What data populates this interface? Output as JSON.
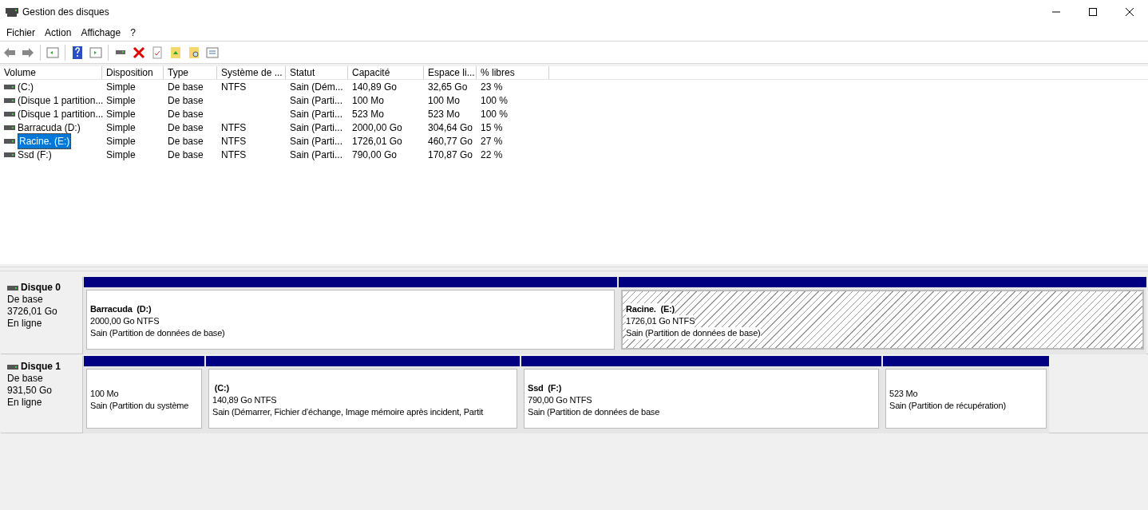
{
  "window": {
    "title": "Gestion des disques"
  },
  "menu": [
    "Fichier",
    "Action",
    "Affichage",
    "?"
  ],
  "table": {
    "columns": [
      "Volume",
      "Disposition",
      "Type",
      "Système de ...",
      "Statut",
      "Capacité",
      "Espace li...",
      "% libres"
    ],
    "rows": [
      {
        "selected": false,
        "cells": [
          " (C:)",
          "Simple",
          "De base",
          "NTFS",
          "Sain (Dém...",
          "140,89 Go",
          "32,65 Go",
          "23 %"
        ]
      },
      {
        "selected": false,
        "cells": [
          "(Disque 1 partition...",
          "Simple",
          "De base",
          "",
          "Sain (Parti...",
          "100 Mo",
          "100 Mo",
          "100 %"
        ]
      },
      {
        "selected": false,
        "cells": [
          "(Disque 1 partition...",
          "Simple",
          "De base",
          "",
          "Sain (Parti...",
          "523 Mo",
          "523 Mo",
          "100 %"
        ]
      },
      {
        "selected": false,
        "cells": [
          "Barracuda (D:)",
          "Simple",
          "De base",
          "NTFS",
          "Sain (Parti...",
          "2000,00 Go",
          "304,64 Go",
          "15 %"
        ]
      },
      {
        "selected": true,
        "cells": [
          "Racine. (E:)",
          "Simple",
          "De base",
          "NTFS",
          "Sain (Parti...",
          "1726,01 Go",
          "460,77 Go",
          "27 %"
        ]
      },
      {
        "selected": false,
        "cells": [
          "Ssd (F:)",
          "Simple",
          "De base",
          "NTFS",
          "Sain (Parti...",
          "790,00 Go",
          "170,87 Go",
          "22 %"
        ]
      }
    ]
  },
  "disks": [
    {
      "name": "Disque 0",
      "type": "De base",
      "size": "3726,01 Go",
      "status": "En ligne",
      "partitions": [
        {
          "label": "Barracuda  (D:)",
          "size": "2000,00 Go NTFS",
          "status": "Sain (Partition de données de base)",
          "selected": false
        },
        {
          "label": "Racine.  (E:)",
          "size": "1726,01 Go NTFS",
          "status": "Sain (Partition de données de base)",
          "selected": true
        }
      ]
    },
    {
      "name": "Disque 1",
      "type": "De base",
      "size": "931,50 Go",
      "status": "En ligne",
      "partitions": [
        {
          "size": "100 Mo",
          "status": "Sain (Partition du système",
          "selected": false
        },
        {
          "label": " (C:)",
          "size": "140,89 Go NTFS",
          "status": "Sain (Démarrer, Fichier d’échange, Image mémoire après incident, Partit",
          "selected": false
        },
        {
          "label": "Ssd  (F:)",
          "size": "790,00 Go NTFS",
          "status": "Sain (Partition de données de base",
          "selected": false
        },
        {
          "size": "523 Mo",
          "status": "Sain (Partition de récupération)",
          "selected": false
        }
      ]
    }
  ]
}
